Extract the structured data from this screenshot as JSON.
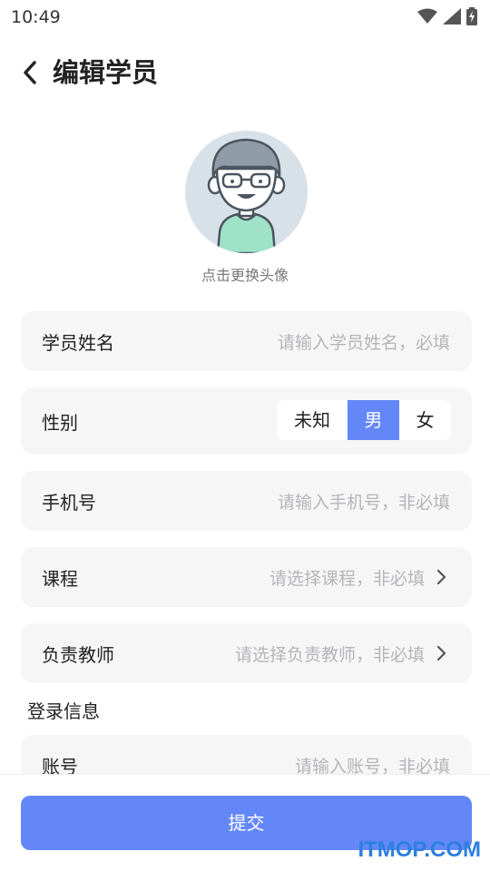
{
  "status_bar": {
    "time": "10:49",
    "icons": [
      "wifi-icon",
      "cellular-signal-icon",
      "battery-charging-icon"
    ]
  },
  "header": {
    "title": "编辑学员",
    "back_icon": "chevron-left-icon"
  },
  "avatar": {
    "hint": "点击更换头像",
    "icon": "student-avatar-icon"
  },
  "form": {
    "name": {
      "label": "学员姓名",
      "placeholder": "请输入学员姓名，必填"
    },
    "gender": {
      "label": "性别",
      "options": [
        "未知",
        "男",
        "女"
      ],
      "selected": "男"
    },
    "phone": {
      "label": "手机号",
      "placeholder": "请输入手机号，非必填"
    },
    "course": {
      "label": "课程",
      "placeholder": "请选择课程，非必填"
    },
    "teacher": {
      "label": "负责教师",
      "placeholder": "请选择负责教师，非必填"
    }
  },
  "login_section": {
    "title": "登录信息",
    "account": {
      "label": "账号",
      "placeholder": "请输入账号，非必填"
    }
  },
  "submit": {
    "label": "提交"
  },
  "watermark": {
    "text": "ITMOP.COM"
  },
  "colors": {
    "accent": "#6487f8",
    "card_bg": "#f6f6f7",
    "placeholder": "#b5b5b8",
    "watermark": "#2c7fe0"
  }
}
